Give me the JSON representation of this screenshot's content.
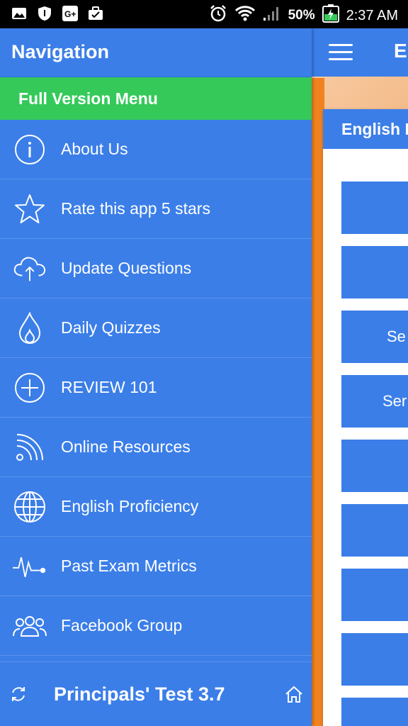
{
  "status_bar": {
    "battery_percent": "50%",
    "time": "2:37 AM",
    "left_icons": [
      "image-icon",
      "shield-icon",
      "google-plus-icon",
      "briefcase-icon"
    ],
    "right_icons": [
      "alarm-icon",
      "wifi-icon",
      "signal-icon",
      "battery-charging-icon"
    ]
  },
  "drawer": {
    "title": "Navigation",
    "full_version_label": "Full Version Menu",
    "items": [
      {
        "label": "About Us",
        "icon": "info-icon"
      },
      {
        "label": "Rate this app 5 stars",
        "icon": "star-icon"
      },
      {
        "label": "Update Questions",
        "icon": "cloud-upload-icon"
      },
      {
        "label": "Daily Quizzes",
        "icon": "flame-icon"
      },
      {
        "label": "REVIEW 101",
        "icon": "plus-circle-icon"
      },
      {
        "label": "Online Resources",
        "icon": "rss-icon"
      },
      {
        "label": "English Proficiency",
        "icon": "globe-icon"
      },
      {
        "label": "Past Exam Metrics",
        "icon": "pulse-icon"
      },
      {
        "label": "Facebook Group",
        "icon": "group-icon"
      }
    ],
    "footer_title": "Principals' Test 3.7"
  },
  "background_app": {
    "title_clipped": "E",
    "card_header": "English I",
    "buttons": [
      "",
      "",
      "Se",
      "Ser",
      "",
      "",
      "",
      "",
      ""
    ]
  },
  "colors": {
    "primary_blue": "#3b7ee8",
    "green": "#35c95a",
    "orange": "#f08220"
  }
}
